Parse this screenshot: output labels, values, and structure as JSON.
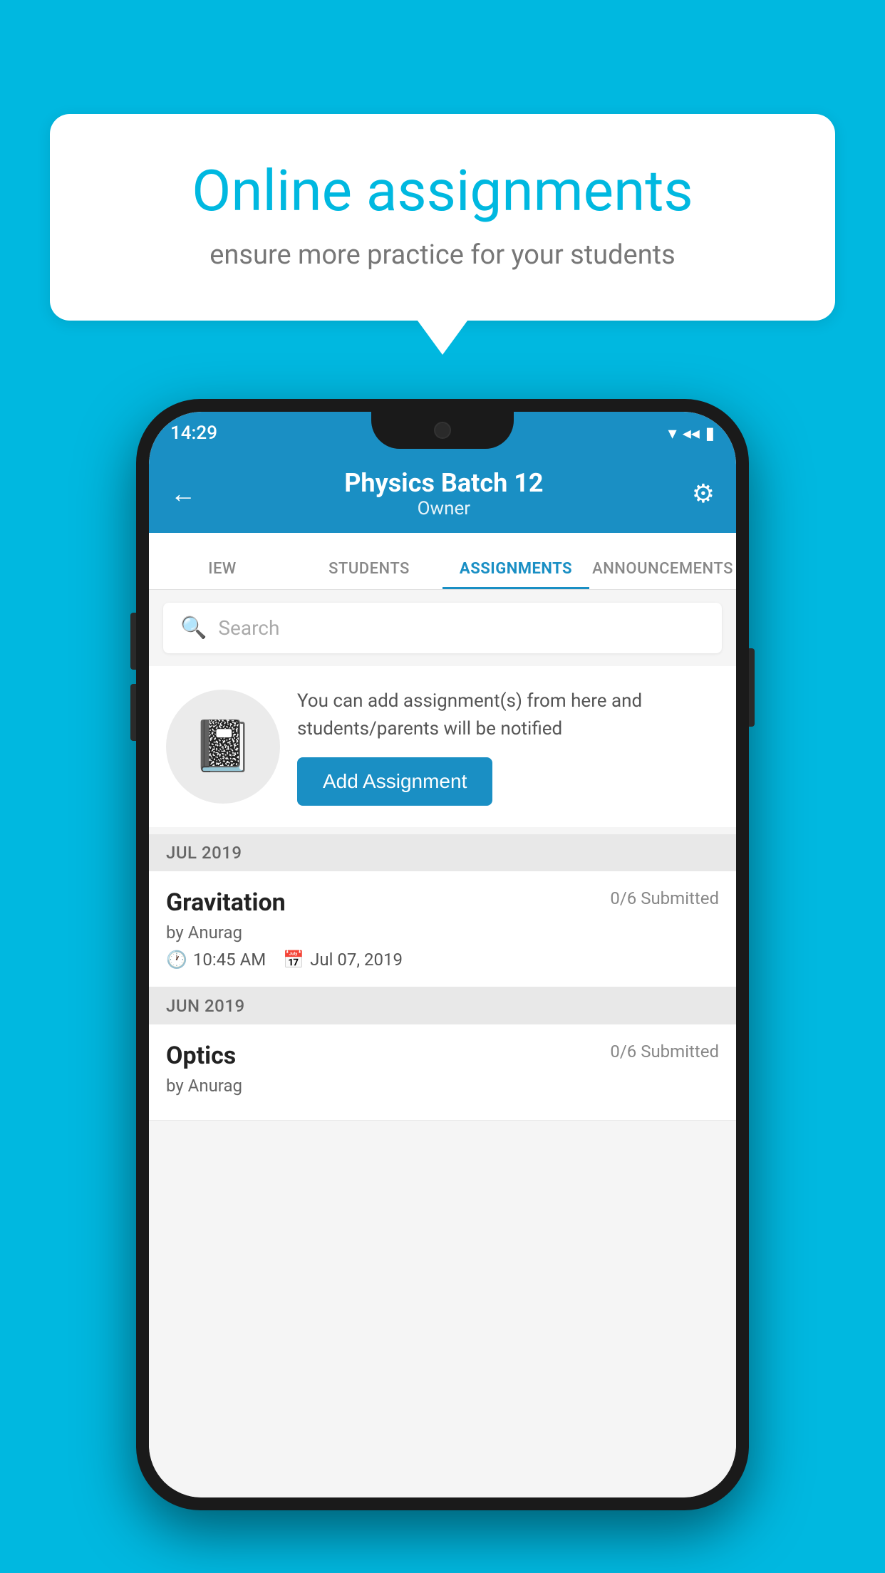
{
  "background_color": "#00b8e0",
  "speech_bubble": {
    "title": "Online assignments",
    "subtitle": "ensure more practice for your students"
  },
  "status_bar": {
    "time": "14:29",
    "wifi_icon": "▾",
    "signal_icon": "◂",
    "battery_icon": "▮"
  },
  "header": {
    "back_label": "←",
    "title": "Physics Batch 12",
    "subtitle": "Owner",
    "settings_label": "⚙"
  },
  "tabs": [
    {
      "label": "IEW",
      "active": false
    },
    {
      "label": "STUDENTS",
      "active": false
    },
    {
      "label": "ASSIGNMENTS",
      "active": true
    },
    {
      "label": "ANNOUNCEMENTS",
      "active": false
    }
  ],
  "search": {
    "placeholder": "Search"
  },
  "promo": {
    "description": "You can add assignment(s) from here and students/parents will be notified",
    "button_label": "Add Assignment"
  },
  "sections": [
    {
      "header": "JUL 2019",
      "assignments": [
        {
          "title": "Gravitation",
          "submitted": "0/6 Submitted",
          "by": "by Anurag",
          "time": "10:45 AM",
          "date": "Jul 07, 2019"
        }
      ]
    },
    {
      "header": "JUN 2019",
      "assignments": [
        {
          "title": "Optics",
          "submitted": "0/6 Submitted",
          "by": "by Anurag",
          "time": "",
          "date": ""
        }
      ]
    }
  ]
}
